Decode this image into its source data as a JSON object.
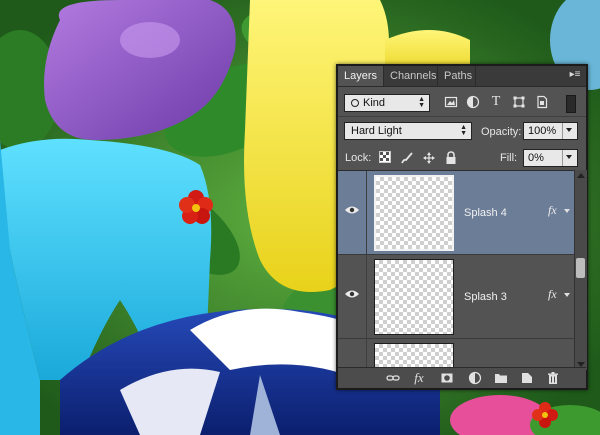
{
  "panel": {
    "tabs": [
      "Layers",
      "Channels",
      "Paths"
    ],
    "menu_icon": "panel-menu-icon"
  },
  "filter": {
    "kind_label": "Kind",
    "icons": [
      "image-filter-icon",
      "adjustment-filter-icon",
      "type-filter-icon",
      "shape-filter-icon",
      "smart-object-filter-icon"
    ]
  },
  "blend": {
    "mode": "Hard Light",
    "opacity_label": "Opacity:",
    "opacity_value": "100%"
  },
  "lock": {
    "label": "Lock:",
    "fill_label": "Fill:",
    "fill_value": "0%",
    "icons": [
      "lock-transparent-icon",
      "lock-image-icon",
      "lock-position-icon",
      "lock-all-icon"
    ]
  },
  "layers": [
    {
      "name": "Splash 4",
      "fx": "fx",
      "selected": true
    },
    {
      "name": "Splash 3",
      "fx": "fx",
      "selected": false
    },
    {
      "name": "",
      "fx": "",
      "selected": false
    }
  ],
  "footer_icons": [
    "link-layers-icon",
    "fx-icon",
    "mask-icon",
    "adjustment-layer-icon",
    "group-folder-icon",
    "new-layer-icon",
    "trash-icon"
  ],
  "colors": {
    "panel_bg": "#535353",
    "selected_layer": "#6c7d98",
    "tab_bar": "#3a3a3a"
  }
}
